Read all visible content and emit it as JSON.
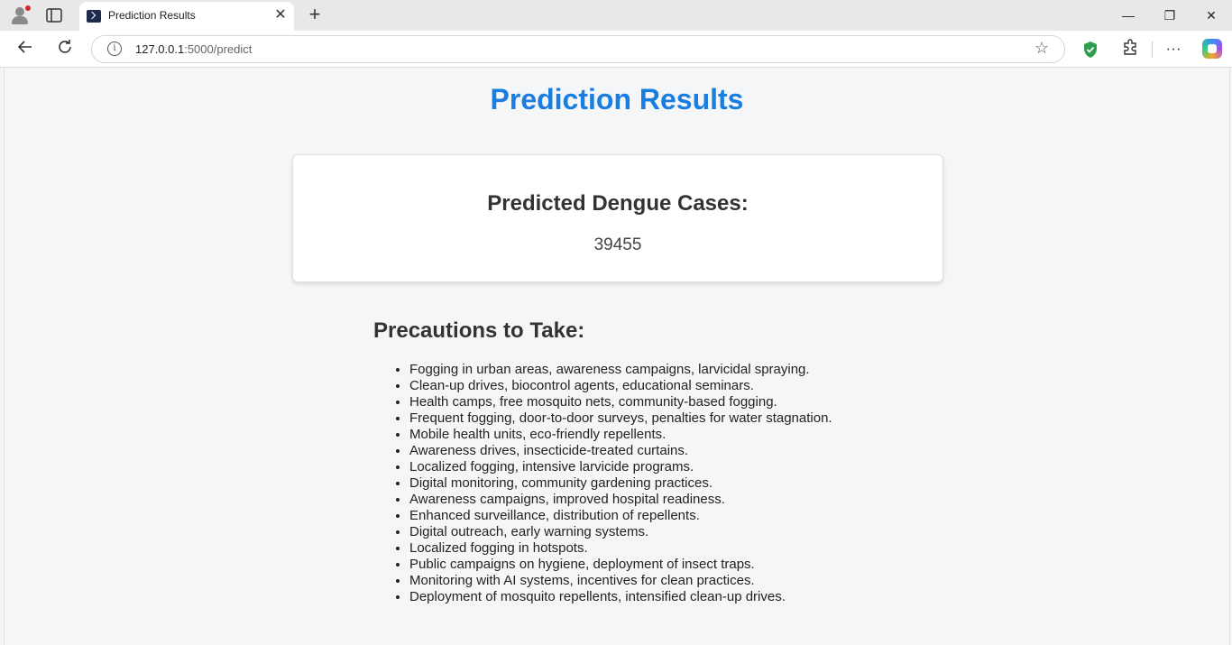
{
  "browser": {
    "tab_title": "Prediction Results",
    "url_host": "127.0.0.1",
    "url_path": ":5000/predict"
  },
  "page": {
    "title": "Prediction Results",
    "result_label": "Predicted Dengue Cases:",
    "result_value": "39455",
    "precautions_heading": "Precautions to Take:",
    "precautions": [
      "Fogging in urban areas, awareness campaigns, larvicidal spraying.",
      "Clean-up drives, biocontrol agents, educational seminars.",
      "Health camps, free mosquito nets, community-based fogging.",
      "Frequent fogging, door-to-door surveys, penalties for water stagnation.",
      "Mobile health units, eco-friendly repellents.",
      "Awareness drives, insecticide-treated curtains.",
      "Localized fogging, intensive larvicide programs.",
      "Digital monitoring, community gardening practices.",
      "Awareness campaigns, improved hospital readiness.",
      "Enhanced surveillance, distribution of repellents.",
      "Digital outreach, early warning systems.",
      "Localized fogging in hotspots.",
      "Public campaigns on hygiene, deployment of insect traps.",
      "Monitoring with AI systems, incentives for clean practices.",
      "Deployment of mosquito repellents, intensified clean-up drives."
    ]
  },
  "colors": {
    "title": "#1a7ee0",
    "text": "#333333",
    "background": "#f5f6f8"
  }
}
